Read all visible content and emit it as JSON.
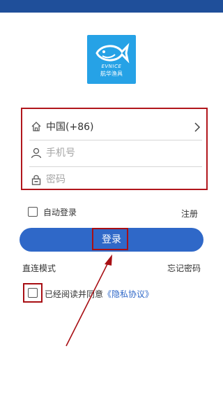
{
  "logo": {
    "brand": "EVNICE",
    "sub": "航华渔具"
  },
  "form": {
    "region_label": "中国(+86)",
    "phone_placeholder": "手机号",
    "password_placeholder": "密码"
  },
  "auto_login_label": "自动登录",
  "register_label": "注册",
  "login_label": "登录",
  "direct_mode_label": "直连模式",
  "forgot_password_label": "忘记密码",
  "agreement": {
    "text": "已经阅读并同意",
    "link": "《隐私协议》"
  },
  "colors": {
    "status_bar": "#1f4f9a",
    "primary": "#2f68c8",
    "highlight": "#b1161c",
    "logo_bg": "#26a2e6"
  },
  "icons": [
    "home-icon",
    "user-icon",
    "lock-icon",
    "chevron-right-icon",
    "fish-logo-icon"
  ]
}
